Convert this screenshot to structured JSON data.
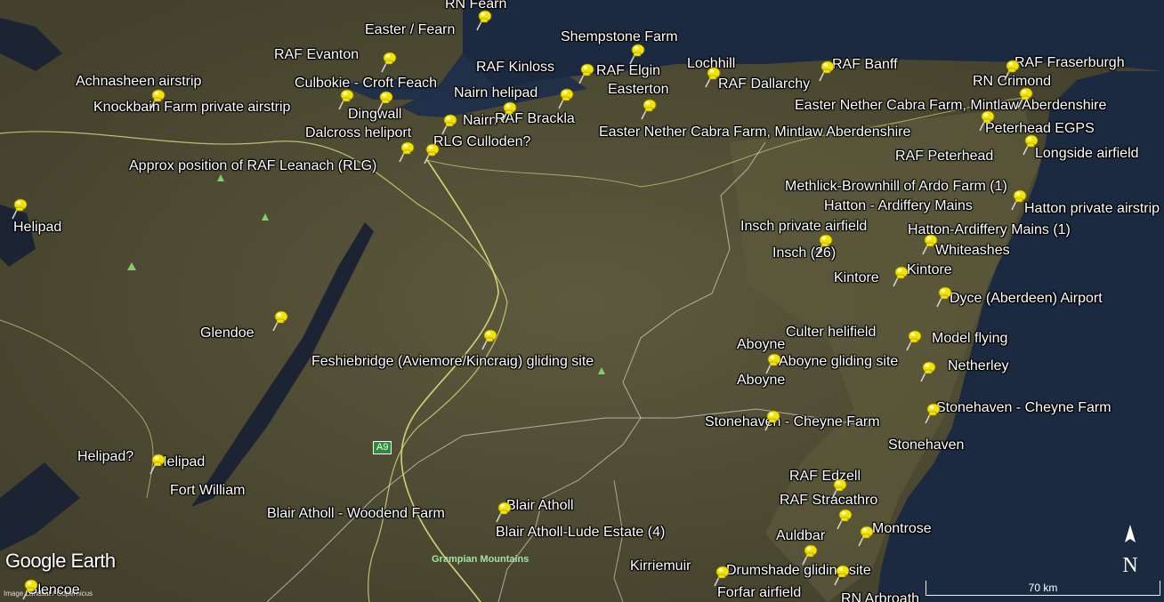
{
  "map": {
    "brand": "Google Earth",
    "copyright": "Image Landsat / Copernicus",
    "north_label": "N",
    "scale_label": "70 km",
    "road_label": "A9",
    "region_label": "Grampian Mountains",
    "colors": {
      "sea": "#1b2a40",
      "land": "#4e4a34",
      "border": "#ffffff",
      "road": "#e6df7a",
      "pin": "#f2e300"
    }
  },
  "labels": [
    "RN Fearn",
    "Easter / Fearn",
    "Shempstone Farm",
    "RAF Evanton",
    "RAF Kinloss",
    "RAF Elgin",
    "Lochhill",
    "RAF Banff",
    "RAF Fraserburgh",
    "RN Crimond",
    "Achnasheen airstrip",
    "Culbokie - Croft Feach",
    "Easterton",
    "RAF Dallarchy",
    "Nairn helipad",
    "Knockbain Farm private airstrip",
    "Dingwall",
    "Nairn",
    "RAF Brackla",
    "Easter Nether Cabra Farm, Mintlaw Aberdenshire",
    "Peterhead EGPS",
    "Dalcross heliport",
    "RLG Culloden?",
    "Easter Nether Cabra Farm, Mintlaw Aberdenshire",
    "RAF Peterhead",
    "Longside airfield",
    "Approx position of RAF Leanach (RLG)",
    "Methlick-Brownhill of Ardo Farm (1)",
    "Hatton - Ardiffery Mains",
    "Hatton private airstrip",
    "Helipad",
    "Insch private airfield",
    "Hatton-Ardiffery Mains (1)",
    "Whiteashes",
    "Insch (26)",
    "Kintore",
    "Kintore",
    "Dyce (Aberdeen) Airport",
    "Glendoe",
    "Culter helifield",
    "Model flying",
    "Aboyne",
    "Aboyne gliding site",
    "Feshiebridge (Aviemore/Kincraig) gliding site",
    "Netherley",
    "Aboyne",
    "Stonehaven - Cheyne Farm",
    "Stonehaven - Cheyne Farm",
    "Stonehaven",
    "Helipad?",
    "Helipad",
    "RAF Edzell",
    "Fort William",
    "RAF Stracathro",
    "Blair Atholl",
    "Blair Atholl - Woodend Farm",
    "Montrose",
    "Blair Atholl-Lude Estate (4)",
    "Auldbar",
    "Kirriemuir",
    "Drumshade gliding site",
    "Forfar airfield",
    "Glencoe",
    "RN Arbroath"
  ],
  "pins": [
    "Easter / Fearn",
    "RAF Evanton",
    "RAF Kinloss",
    "RAF Elgin",
    "Lochhill",
    "RAF Banff",
    "RAF Fraserburgh",
    "Achnasheen airstrip",
    "Culbokie - Croft Feach",
    "Dingwall",
    "Nairn helipad",
    "Easterton",
    "Nairn",
    "RAF Brackla",
    "Dalcross heliport",
    "RLG Culloden?",
    "RN Crimond",
    "Peterhead EGPS",
    "Longside airfield",
    "Hatton private airstrip",
    "Helipad",
    "Insch private airfield",
    "Whiteashes",
    "Kintore",
    "Dyce (Aberdeen) Airport",
    "Glendoe",
    "Feshiebridge (Aviemore/Kincraig) gliding site",
    "Model flying",
    "Netherley",
    "Aboyne gliding site",
    "Stonehaven - Cheyne Farm",
    "Stonehaven - Cheyne Farm",
    "Helipad",
    "RAF Edzell",
    "RAF Stracathro",
    "Blair Atholl",
    "Montrose",
    "Auldbar",
    "Drumshade gliding site",
    "Kirriemuir",
    "Glencoe"
  ]
}
